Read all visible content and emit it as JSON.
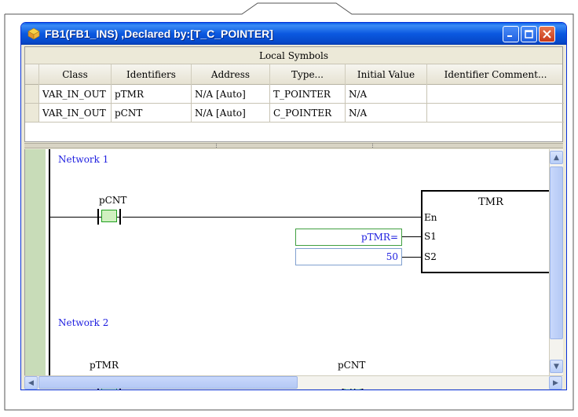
{
  "window": {
    "title": "FB1(FB1_INS) ,Declared by:[T_C_POINTER]"
  },
  "symbols": {
    "title": "Local Symbols",
    "columns": [
      "Class",
      "Identifiers",
      "Address",
      "Type...",
      "Initial Value",
      "Identifier Comment..."
    ],
    "rows": [
      {
        "class": "VAR_IN_OUT",
        "identifier": "pTMR",
        "address": "N/A [Auto]",
        "type": "T_POINTER",
        "initial": "N/A",
        "comment": ""
      },
      {
        "class": "VAR_IN_OUT",
        "identifier": "pCNT",
        "address": "N/A [Auto]",
        "type": "C_POINTER",
        "initial": "N/A",
        "comment": ""
      }
    ]
  },
  "ladder": {
    "network1": {
      "label": "Network 1",
      "contact_label": "pCNT",
      "block_name": "TMR",
      "pin_en": "En",
      "pin_s1": "S1",
      "pin_s2": "S2",
      "s1_value": "pTMR=",
      "s2_value": "50"
    },
    "network2": {
      "label": "Network 2",
      "contact_label": "pTMR",
      "coil_label": "pCNT",
      "coil_text": "R"
    }
  },
  "colors": {
    "titlebar": "#0b58e0",
    "network_label": "#2020e0",
    "contact_fill": "#d0f0c0",
    "rail_strip": "#c8dcb8"
  }
}
